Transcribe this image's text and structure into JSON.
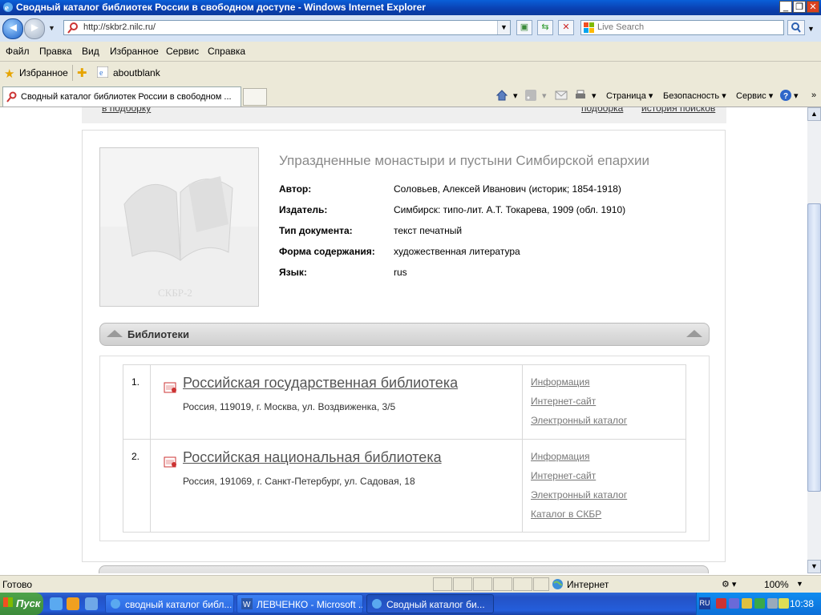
{
  "window": {
    "title": "Сводный каталог библиотек России в свободном доступе - Windows Internet Explorer",
    "minimize": "_",
    "maximize": "❐",
    "close": "✕"
  },
  "address": {
    "url": "http://skbr2.nilc.ru/",
    "search_placeholder": "Live Search"
  },
  "menu": [
    "Файл",
    "Правка",
    "Вид",
    "Избранное",
    "Сервис",
    "Справка"
  ],
  "favorites": {
    "label": "Избранное",
    "item": "aboutblank"
  },
  "tab": {
    "title": "Сводный каталог библиотек России в свободном ..."
  },
  "commands": {
    "page": "Страница",
    "security": "Безопасность",
    "tools": "Сервис"
  },
  "top_links": {
    "left": "в подборку",
    "right1": "подборка",
    "right2": "история поисков"
  },
  "book": {
    "cover_caption": "СКБР-2",
    "title": "Упраздненные монастыри и пустыни Симбирской епархии",
    "fields": [
      {
        "key": "Автор:",
        "value": "Соловьев, Алексей Иванович (историк; 1854-1918)"
      },
      {
        "key": "Издатель:",
        "value": "Симбирск: типо-лит. А.Т. Токарева, 1909 (обл. 1910)"
      },
      {
        "key": "Тип документа:",
        "value": "текст печатный"
      },
      {
        "key": "Форма содержания:",
        "value": "художественная литература"
      },
      {
        "key": "Язык:",
        "value": "rus"
      }
    ]
  },
  "libraries": {
    "header": "Библиотеки",
    "items": [
      {
        "num": "1.",
        "name": "Российская государственная библиотека",
        "address": "Россия, 119019, г. Москва, ул. Воздвиженка, 3/5",
        "links": [
          "Информация",
          "Интернет-сайт",
          "Электронный каталог"
        ]
      },
      {
        "num": "2.",
        "name": "Российская национальная библиотека",
        "address": "Россия, 191069, г. Санкт-Петербург, ул. Садовая, 18",
        "links": [
          "Информация",
          "Интернет-сайт",
          "Электронный каталог",
          "Каталог в СКБР"
        ]
      }
    ]
  },
  "status": {
    "text": "Готово",
    "zone": "Интернет",
    "zoom": "100%"
  },
  "taskbar": {
    "start": "Пуск",
    "buttons": [
      "сводный каталог библ...",
      "ЛЕВЧЕНКО - Microsoft ...",
      "Сводный каталог би..."
    ],
    "lang": "RU",
    "clock": "10:38"
  },
  "colors": {
    "titlebar": "#0a4fc8",
    "taskbar": "#245edb",
    "link": "#777777"
  }
}
